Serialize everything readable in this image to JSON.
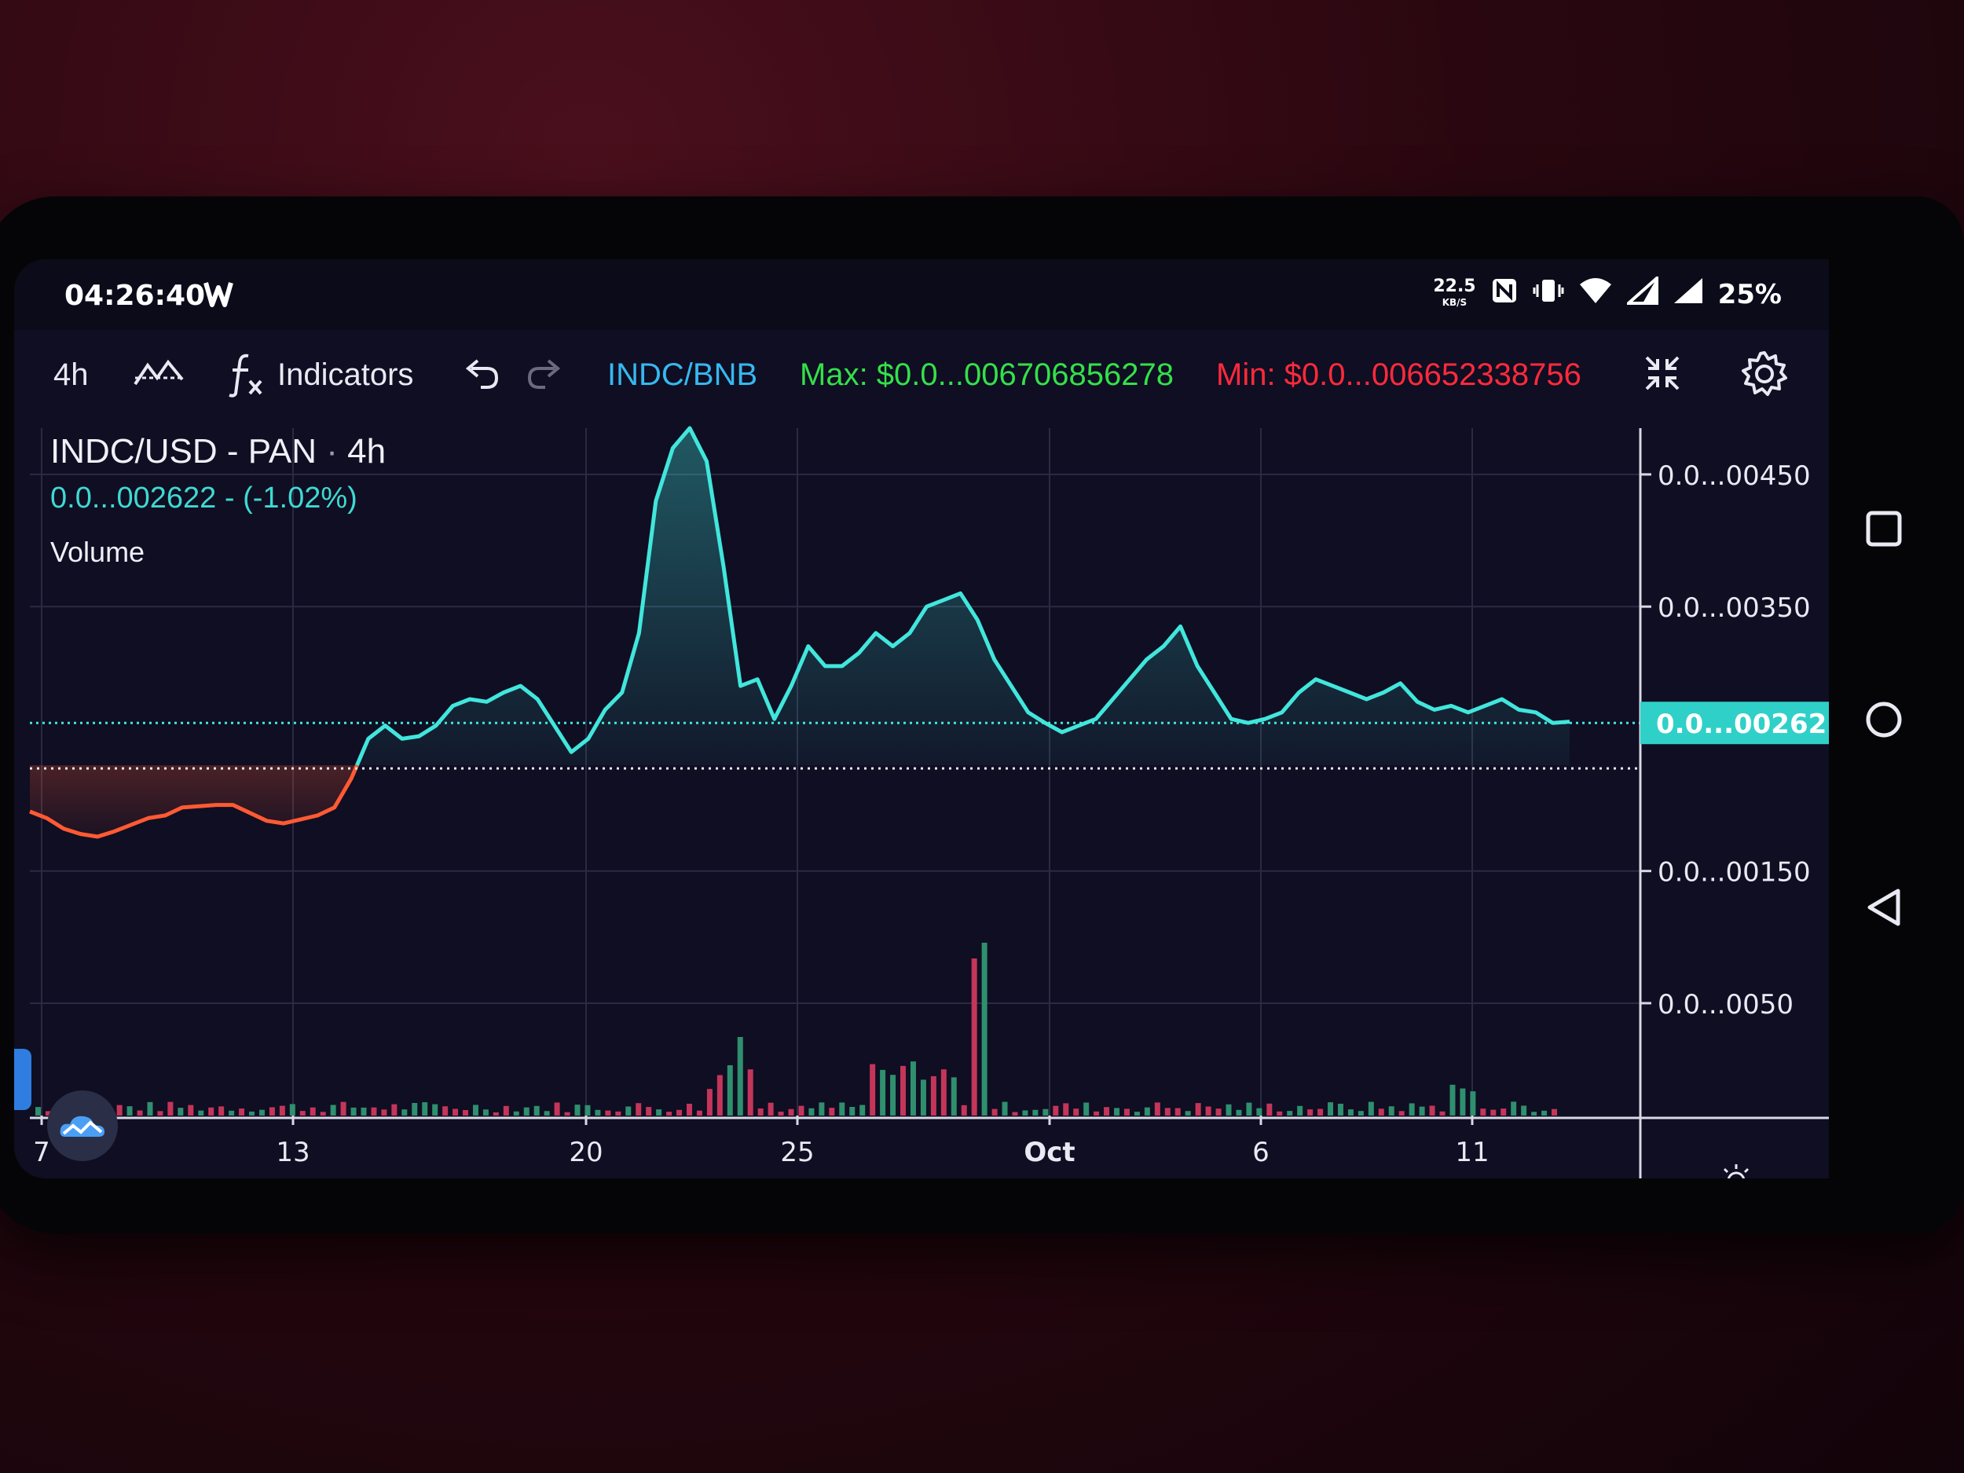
{
  "status": {
    "time": "04:26:40",
    "net_speed": "22.5",
    "net_unit": "KB/S",
    "battery": "25%"
  },
  "toolbar": {
    "interval": "4h",
    "indicators_label": "Indicators",
    "pair": "INDC/BNB",
    "max_text": "Max: $0.0...006706856278",
    "min_text": "Min: $0.0...006652338756"
  },
  "legend": {
    "title": "INDC/USD - PAN",
    "interval": "4h",
    "value": "0.0...002622",
    "change": "- (-1.02%)",
    "volume_label": "Volume"
  },
  "colors": {
    "up_line": "#41e6dc",
    "down_line": "#ff5a33",
    "up_volume": "#2f8f6e",
    "down_volume": "#c4355a",
    "background": "#0f0e22"
  },
  "chart_data": {
    "type": "area",
    "x_ticks": [
      "7",
      "13",
      "20",
      "25",
      "Oct",
      "6",
      "11"
    ],
    "y_ticks": [
      "0.0...00450",
      "0.0...00350",
      "0.0...00150",
      "0.0...0050"
    ],
    "y_tick_values": [
      4.5,
      3.5,
      1.5,
      0.5
    ],
    "y_unit_note": "",
    "current_price_label": "0.0...002622",
    "current_price": 2.62,
    "baseline_price": 2.3,
    "ylim": [
      -0.35,
      4.85
    ],
    "price_series": [
      1.95,
      1.9,
      1.82,
      1.78,
      1.76,
      1.8,
      1.85,
      1.9,
      1.92,
      1.98,
      1.99,
      2.0,
      2.0,
      1.94,
      1.88,
      1.86,
      1.89,
      1.92,
      1.98,
      2.2,
      2.5,
      2.6,
      2.5,
      2.52,
      2.6,
      2.75,
      2.8,
      2.78,
      2.85,
      2.9,
      2.8,
      2.6,
      2.4,
      2.5,
      2.72,
      2.85,
      3.3,
      4.3,
      4.7,
      4.85,
      4.6,
      3.8,
      2.9,
      2.95,
      2.65,
      2.9,
      3.2,
      3.05,
      3.05,
      3.15,
      3.3,
      3.2,
      3.3,
      3.5,
      3.55,
      3.6,
      3.4,
      3.1,
      2.9,
      2.7,
      2.62,
      2.55,
      2.6,
      2.65,
      2.8,
      2.95,
      3.1,
      3.2,
      3.35,
      3.05,
      2.85,
      2.65,
      2.62,
      2.65,
      2.7,
      2.85,
      2.95,
      2.9,
      2.85,
      2.8,
      2.85,
      2.92,
      2.78,
      2.72,
      2.75,
      2.7,
      2.75,
      2.8,
      2.72,
      2.7,
      2.62,
      2.63
    ],
    "price_series_note": "",
    "volume_bars_count": 150
  },
  "nav": {
    "recents": "recents-button",
    "home": "home-button",
    "back": "back-button"
  }
}
